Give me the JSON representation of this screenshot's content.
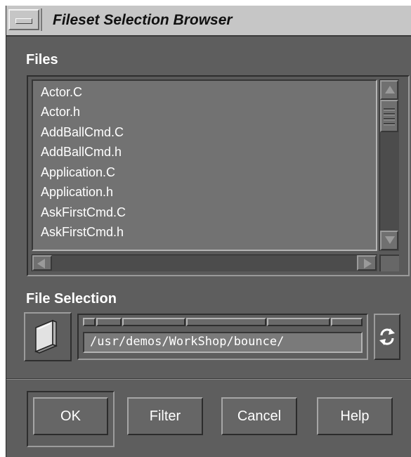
{
  "window": {
    "title": "Fileset Selection Browser"
  },
  "files": {
    "label": "Files",
    "items": [
      "Actor.C",
      "Actor.h",
      "AddBallCmd.C",
      "AddBallCmd.h",
      "Application.C",
      "Application.h",
      "AskFirstCmd.C",
      "AskFirstCmd.h"
    ]
  },
  "selection": {
    "label": "File Selection",
    "path": "/usr/demos/WorkShop/bounce/"
  },
  "buttons": {
    "ok": "OK",
    "filter": "Filter",
    "cancel": "Cancel",
    "help": "Help"
  }
}
